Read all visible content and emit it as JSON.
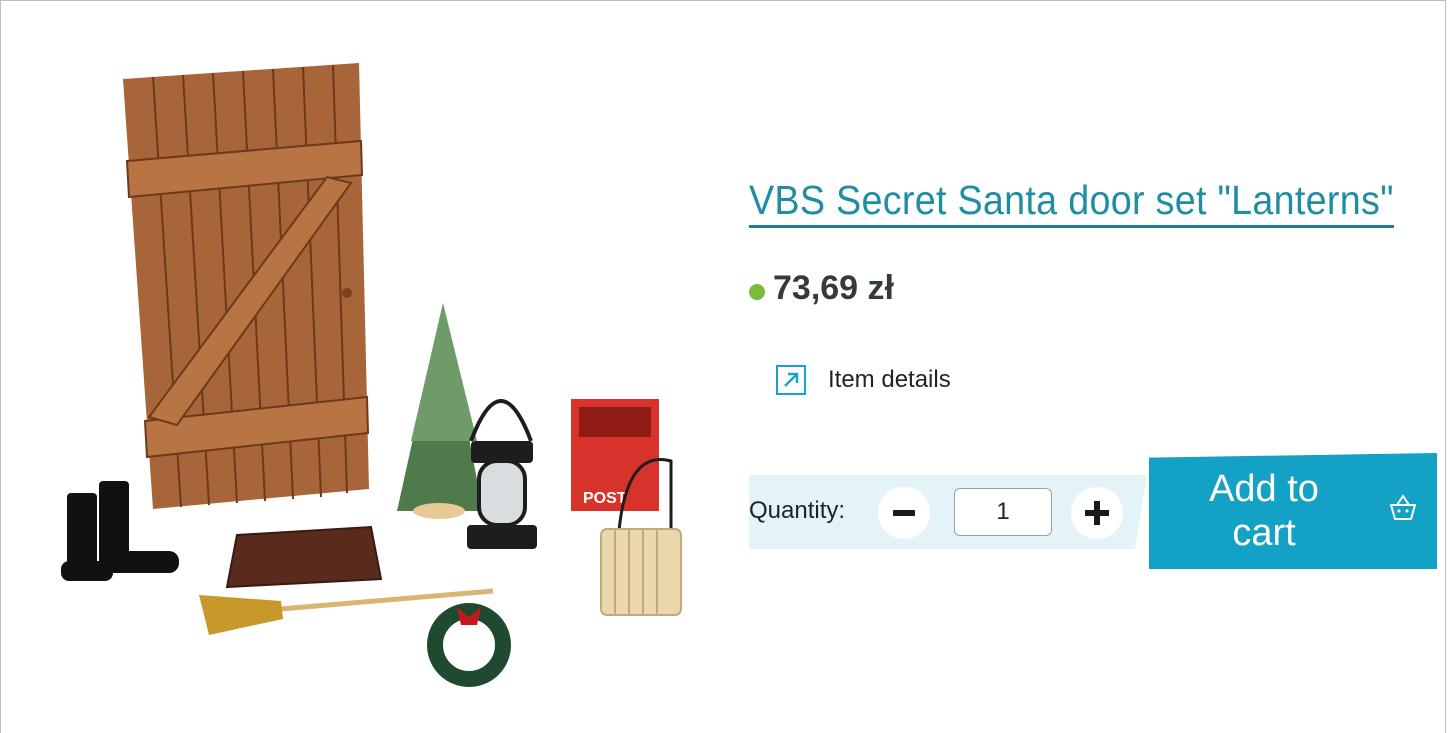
{
  "product": {
    "title": "VBS Secret Santa door set \"Lanterns\"",
    "price": "73,69 zł",
    "availability_color": "#7dba3a",
    "image_alt": "Secret Santa door set with lantern, boots, mat, broom, wreath, mailbox, bucket and tree"
  },
  "details": {
    "label": "Item details",
    "icon": "external-link-icon"
  },
  "quantity": {
    "label": "Quantity:",
    "value": "1",
    "decrement_icon": "minus-icon",
    "increment_icon": "plus-icon"
  },
  "cart": {
    "button_label": "Add to cart",
    "icon": "basket-icon",
    "accent_color": "#14a1c6"
  }
}
